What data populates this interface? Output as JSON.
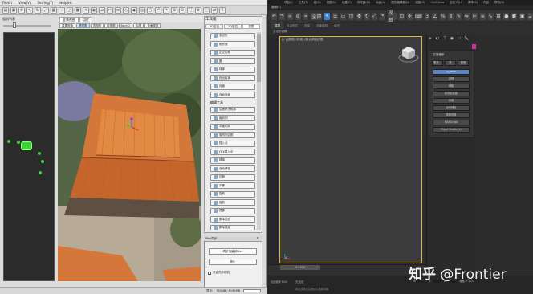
{
  "left_app": {
    "menu": [
      "File(F)",
      "View(V)",
      "Setting(T)",
      "Help(H)"
    ],
    "camera_list_label": "相机列表",
    "view_tabs": [
      {
        "label": "全景视图",
        "active": true
      },
      {
        "label": "切片"
      }
    ],
    "sub_tabs": [
      {
        "label": "重置视角",
        "selected": false
      },
      {
        "label": "透视图",
        "selected": true
      },
      {
        "label": "顶视图",
        "selected": false
      },
      {
        "label": "前视图",
        "selected": false
      },
      {
        "label": "Back 2",
        "selected": false
      },
      {
        "label": "后视",
        "selected": false
      },
      {
        "label": "背面视图",
        "selected": false
      }
    ],
    "tool_panel": {
      "title": "工具箱",
      "tabs": [
        {
          "label": "3D定位",
          "active": false
        },
        {
          "label": "2D定位",
          "active": false
        },
        {
          "label": "建模",
          "active": true
        }
      ],
      "items": [
        {
          "type": "button",
          "label": "多边形"
        },
        {
          "type": "button",
          "label": "矩形面"
        },
        {
          "type": "button",
          "label": "正交边框"
        },
        {
          "type": "button",
          "label": "圆"
        },
        {
          "type": "button",
          "label": "球体"
        },
        {
          "type": "button",
          "label": "挤出柱体"
        },
        {
          "type": "button",
          "label": "封面"
        },
        {
          "type": "button",
          "label": "自动封面"
        },
        {
          "type": "section",
          "label": "编辑工具"
        },
        {
          "type": "button",
          "label": "沿面挤出轮廓"
        },
        {
          "type": "button",
          "label": "面切割"
        },
        {
          "type": "button",
          "label": "平面切片"
        },
        {
          "type": "button",
          "label": "吸附到边框"
        },
        {
          "type": "button",
          "label": "插入点"
        },
        {
          "type": "button",
          "label": "FBX插入点"
        },
        {
          "type": "button",
          "label": "焊接"
        },
        {
          "type": "button",
          "label": "自动焊接"
        },
        {
          "type": "button",
          "label": "拉伸"
        },
        {
          "type": "button",
          "label": "平移"
        },
        {
          "type": "button",
          "label": "旋转"
        },
        {
          "type": "button",
          "label": "缩放"
        },
        {
          "type": "button",
          "label": "镜像"
        },
        {
          "type": "button",
          "label": "删除顶点"
        },
        {
          "type": "button",
          "label": "删除线面"
        },
        {
          "type": "button",
          "label": "合并选集"
        },
        {
          "type": "section",
          "label": "贴图工具"
        },
        {
          "type": "button",
          "label": "自动贴图映射"
        },
        {
          "type": "button",
          "label": "手动贴图"
        }
      ]
    },
    "sync_dialog": {
      "title": "Max同步",
      "button_sync": "同步场景到Max",
      "button_stop": "停止",
      "checkbox_label": "开启同步相机"
    },
    "status_bar": {
      "label": "显存:",
      "value": "783MB / 8192MB"
    }
  },
  "right_app": {
    "title_items": [
      "项目(I)",
      "工具(T)",
      "组(G)",
      "视图(V)",
      "创建(C)",
      "修改器(M)",
      "动画(A)",
      "图形编辑器(D)",
      "渲染(R)",
      "Civil View",
      "自定义(U)",
      "脚本(S)",
      "内容",
      "帮助(H)"
    ],
    "menubar_text": "编辑(E)",
    "tabs": [
      {
        "label": "建模",
        "active": true
      },
      {
        "label": "自由形式",
        "active": false
      },
      {
        "label": "选择",
        "active": false
      },
      {
        "label": "对象绘制",
        "active": false
      },
      {
        "label": "填充",
        "active": false
      }
    ],
    "subtab": "多边形建模",
    "viewport_label": "[+] [透视] [标准] [默认明暗处理]",
    "command_panel": {
      "rollout_title": "- 实用程序",
      "top_buttons": [
        "更多...",
        "集",
        "配置"
      ],
      "buttons": [
        {
          "label": "sc_max",
          "selected": true
        },
        {
          "label": "透视"
        },
        {
          "label": "塌陷"
        },
        {
          "label": "颜色剪贴板"
        },
        {
          "label": "测量"
        },
        {
          "label": "运动捕捉"
        },
        {
          "label": "重置变换"
        },
        {
          "label": "MAXScript"
        },
        {
          "label": "Flight Studio (c)"
        }
      ]
    },
    "timeline": {
      "slider": "0 / 100"
    },
    "status": {
      "line1": "无选定",
      "line2": "单击或单击并拖动以选择对象",
      "script_label": "欢迎使用 MAX"
    },
    "coords": {
      "x_label": "X:",
      "y_label": "Y:",
      "z_label": "Z:",
      "grid_label": "栅格 = 10.0"
    }
  },
  "watermark": {
    "logo": "知乎",
    "handle": "@Frontier"
  },
  "colors": {
    "viewport_border": "#e0b33b",
    "selection_blue": "#3d7fd6",
    "swatch": "#d52cb0",
    "camera_green": "#3ad13a",
    "roof_orange": "#d4773a"
  }
}
